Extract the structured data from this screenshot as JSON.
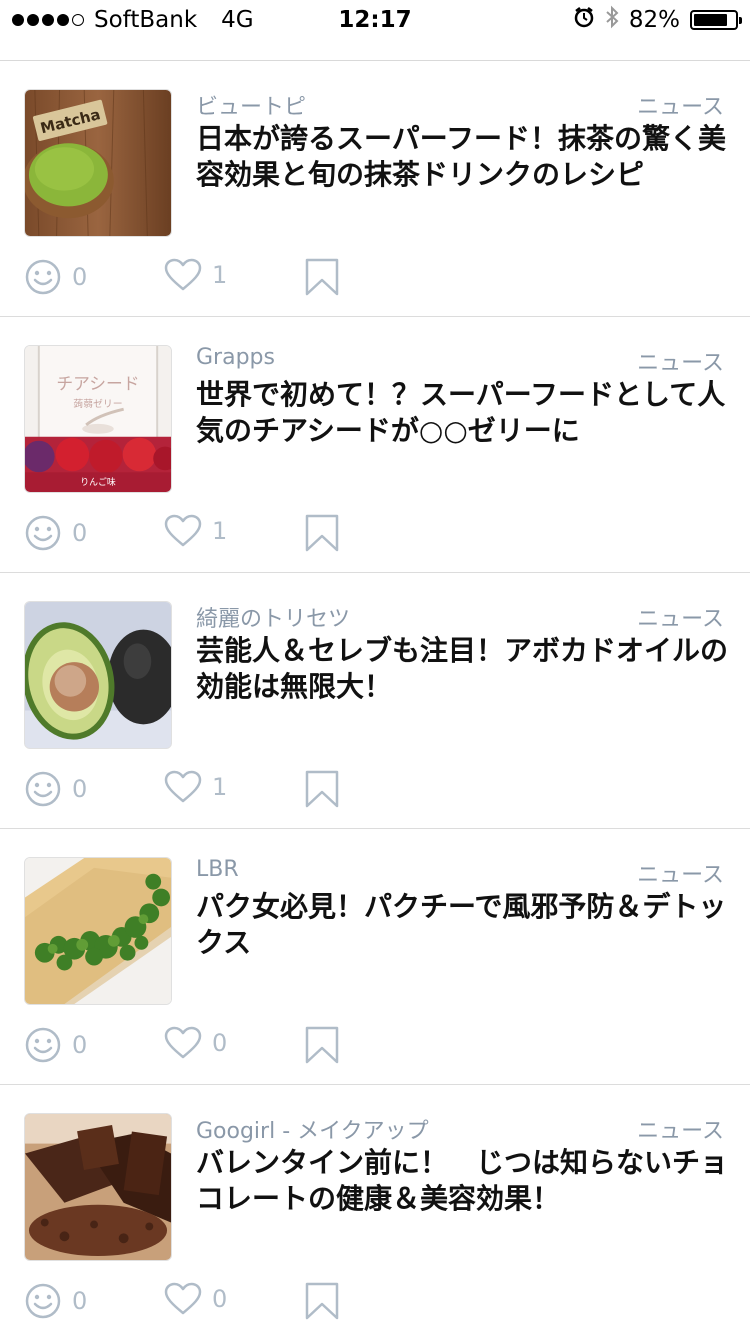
{
  "status_bar": {
    "carrier": "SoftBank",
    "network": "4G",
    "time": "12:17",
    "battery": "82%",
    "battery_level": 0.82
  },
  "articles": [
    {
      "source": "ビュートピ",
      "category": "ニュース",
      "title": "日本が誇るスーパーフード！抹茶の驚く美容効果と旬の抹茶ドリンクのレシピ",
      "thumb_text": "Matcha",
      "smile_count": "0",
      "like_count": "1"
    },
    {
      "source": "Grapps",
      "category": "ニュース",
      "title": "世界で初めて！？スーパーフードとして人気のチアシードが○○ゼリーに",
      "thumb_text": "チアシード",
      "thumb_sub": "蒟蒻ゼリー",
      "thumb_flavor": "りんご味",
      "smile_count": "0",
      "like_count": "1"
    },
    {
      "source": "綺麗のトリセツ",
      "category": "ニュース",
      "title": "芸能人＆セレブも注目！アボカドオイルの効能は無限大！",
      "smile_count": "0",
      "like_count": "1"
    },
    {
      "source": "LBR",
      "category": "ニュース",
      "title": "パク女必見！パクチーで風邪予防＆デトックス",
      "smile_count": "0",
      "like_count": "0"
    },
    {
      "source": "Googirl - メイクアップ",
      "category": "ニュース",
      "title": "バレンタイン前に！　じつは知らないチョコレートの健康＆美容効果！",
      "smile_count": "0",
      "like_count": "0"
    }
  ],
  "colors": {
    "meta": "#8a98a8",
    "icon": "#b0bcc8",
    "title": "#111111"
  }
}
